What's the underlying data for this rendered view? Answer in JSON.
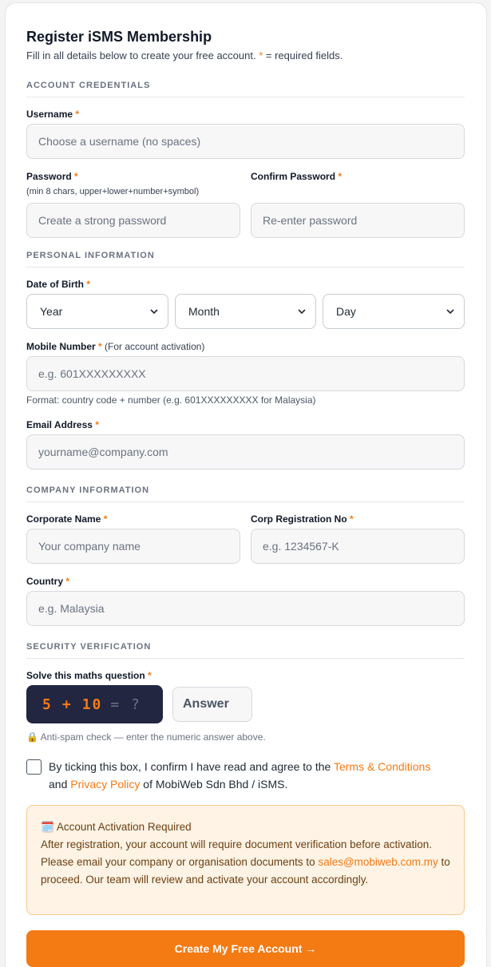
{
  "form": {
    "title": "Register iSMS Membership",
    "subtitle": "Fill in all details below to create your free account.",
    "required_mark": "*",
    "required_suffix": "= required fields.",
    "accent_color": "#f47a13"
  },
  "sections": {
    "account": "ACCOUNT CREDENTIALS",
    "personal": "PERSONAL INFORMATION",
    "company": "COMPANY INFORMATION",
    "security": "SECURITY VERIFICATION"
  },
  "fields": {
    "username": {
      "label": "Username",
      "placeholder": "Choose a username (no spaces)"
    },
    "password": {
      "label": "Password",
      "hint": "(min 8 chars, upper+lower+number+symbol)",
      "placeholder": "Create a strong password"
    },
    "confirm_password": {
      "label": "Confirm Password",
      "placeholder": "Re-enter password"
    },
    "dob": {
      "label": "Date of Birth",
      "year": "Year",
      "month": "Month",
      "day": "Day"
    },
    "mobile": {
      "label": "Mobile Number",
      "note": "(For account activation)",
      "placeholder": "e.g. 601XXXXXXXXX",
      "hint": "Format: country code + number (e.g. 601XXXXXXXXX for Malaysia)"
    },
    "email": {
      "label": "Email Address",
      "placeholder": "yourname@company.com"
    },
    "corporate_name": {
      "label": "Corporate Name",
      "placeholder": "Your company name"
    },
    "corp_reg_no": {
      "label": "Corp Registration No",
      "placeholder": "e.g. 1234567-K"
    },
    "country": {
      "label": "Country",
      "placeholder": "e.g. Malaysia"
    }
  },
  "security": {
    "label": "Solve this maths question",
    "captcha_a": "5",
    "captcha_op": "+",
    "captcha_b": "10",
    "captcha_eq": "= ?",
    "answer_placeholder": "Answer",
    "hint": "🔒 Anti-spam check — enter the numeric answer above."
  },
  "consent": {
    "text_before": "By ticking this box, I confirm I have read and agree to the",
    "terms_link": "Terms & Conditions",
    "and": "and",
    "privacy_link": "Privacy Policy",
    "text_after": "of MobiWeb Sdn Bhd / iSMS.",
    "checked": false
  },
  "notice": {
    "icon": "🗓️",
    "title": "Account Activation Required",
    "body_before": "After registration, your account will require document verification before activation. Please email your company or organisation documents to",
    "email": "sales@mobiweb.com.my",
    "body_after": "to proceed. Our team will review and activate your account accordingly."
  },
  "submit": {
    "label": "Create My Free Account →"
  }
}
